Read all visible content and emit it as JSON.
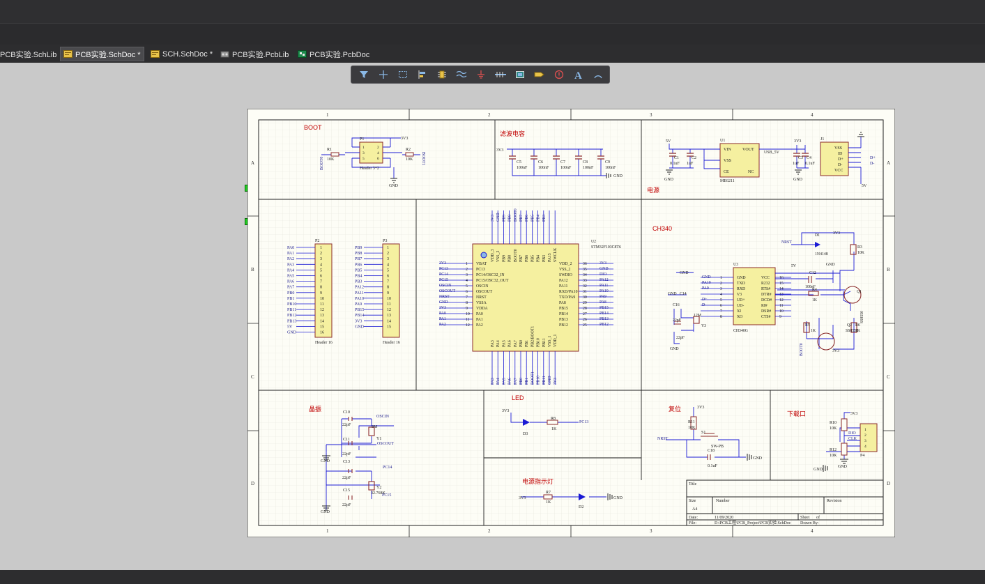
{
  "tabs": [
    {
      "label": "PCB实验.SchLib",
      "icon": "schlib-icon"
    },
    {
      "label": "PCB实验.SchDoc *",
      "icon": "schdoc-icon",
      "active": true
    },
    {
      "label": "SCH.SchDoc *",
      "icon": "schdoc-icon"
    },
    {
      "label": "PCB实验.PcbLib",
      "icon": "pcblib-icon"
    },
    {
      "label": "PCB实验.PcbDoc",
      "icon": "pcbdoc-icon"
    }
  ],
  "toolbar_icons": [
    "filter-icon",
    "cross-probe-icon",
    "select-rect-icon",
    "align-icon",
    "component-icon",
    "wire-icon",
    "ground-power-icon",
    "bus-icon",
    "sheet-symbol-icon",
    "port-icon",
    "directive-icon",
    "text-icon",
    "arc-icon"
  ],
  "colors": {
    "wire": "#1a1ad4",
    "part_fill": "#f5f0a0",
    "label_red": "#c00000",
    "net_blue": "#1a1a8c",
    "sheet_bg": "#fdfdf6",
    "grid": "#e4e4da"
  },
  "sheet": {
    "col_labels": [
      "1",
      "2",
      "3",
      "4"
    ],
    "row_labels": [
      "A",
      "B",
      "C",
      "D"
    ],
    "titles": {
      "boot": "BOOT",
      "filter": "滤波电容",
      "power": "电源",
      "ch340": "CH340",
      "crystal": "晶振",
      "led": "LED",
      "reset": "复位",
      "download": "下载口",
      "power_led": "电源指示灯"
    },
    "title_block": {
      "title": "Title",
      "size": "Size",
      "size_val": "A4",
      "number": "Number",
      "revision": "Revision",
      "date": "Date:",
      "date_val": "11/09/2020",
      "sheet": "Sheet",
      "of": "of",
      "file": "File:",
      "file_val": "D:\\PCB工程\\PCB_Project\\PCB实验.SchDoc",
      "drawn": "Drawn By:"
    },
    "parts": {
      "p1": "P1",
      "header32": "Header 3*2",
      "r1": "R1",
      "r2": "R2",
      "r10k": "10K",
      "boot0": "BOOT0",
      "boot1": "BOOT1",
      "v33": "3V3",
      "gnd": "GND",
      "c5": "C5",
      "c6": "C6",
      "c7": "C7",
      "c8": "C8",
      "c9": "C9",
      "c100nf": "100nF",
      "u1": "U1",
      "me6211": "ME6211",
      "vin": "VIN",
      "vout": "VOUT",
      "vss": "VSS",
      "ce": "CE",
      "nc": "NC",
      "c1": "C1",
      "c2": "C2",
      "c3": "C3",
      "c4": "C4",
      "c1uf": "1uF",
      "c01uf": "0.1uF",
      "v5": "5V",
      "usb_5v": "USB_5V",
      "j1": "J1",
      "j_id": "ID",
      "j_dp": "D+",
      "j_dm": "D-",
      "j_vcc": "VCC",
      "p2": "P2",
      "p3": "P3",
      "header16": "Header 16",
      "u2": "U2",
      "stm32": "STM32F103C8T6",
      "u3": "U3",
      "ch340g": "CH340G",
      "d1": "D1",
      "in4148": "1N4148",
      "r3": "R3",
      "r4": "R4",
      "r1k": "1K",
      "q1": "Q1",
      "q2": "Q2",
      "ss8550": "SS8550",
      "r5": "R5",
      "r6": "R6",
      "c12": "C12",
      "c14": "C14",
      "c16": "C16",
      "y3": "Y3",
      "y3_val": "12M",
      "c22pf": "22pF",
      "nrst": "NRST",
      "c10": "C10",
      "c11": "C11",
      "c13": "C13",
      "c15": "C15",
      "y1": "Y1",
      "y2": "Y2",
      "y1_val": "8M",
      "y2_val": "32.768K",
      "oscin": "OSCIN",
      "oscout": "OSCOUT",
      "pc14": "PC14",
      "pc15": "PC15",
      "d3": "D3",
      "r8": "R8",
      "pc13": "PC13",
      "r11": "R11",
      "s1": "S1",
      "swpb": "SW-PB",
      "c18": "C18",
      "r10": "R10",
      "r12": "R12",
      "p4": "P4",
      "dio": "DIO",
      "clk": "CLK",
      "r7": "R7",
      "d2": "D2"
    },
    "p2_pins": [
      "PA0",
      "PA1",
      "PA2",
      "PA3",
      "PA4",
      "PA5",
      "PA6",
      "PA7",
      "PB0",
      "PB1",
      "PB10",
      "PB11",
      "PB12",
      "PB13",
      "5V",
      "GND"
    ],
    "p3_pins": [
      "PB9",
      "PB8",
      "PB7",
      "PB6",
      "PB5",
      "PB4",
      "PB3",
      "PA12",
      "PA11",
      "PA10",
      "PA9",
      "PB15",
      "PB14",
      "3V3",
      "GND"
    ],
    "u2_left": [
      "VBAT",
      "PC13",
      "PC14/OSC32_IN",
      "PC15/OSC32_OUT",
      "OSCIN",
      "OSCOUT",
      "NRST",
      "VSSA",
      "VDDA",
      "PA0",
      "PA1",
      "PA2"
    ],
    "u2_left_nets": [
      "3V3",
      "PC13",
      "PC14",
      "PC15",
      "OSCIN",
      "OSCOUT",
      "NRST",
      "GND",
      "3V3",
      "PA0",
      "PA1",
      "PA2"
    ],
    "u2_right": [
      "VDD_2",
      "VSS_2",
      "SWDIO",
      "PA12",
      "PA11",
      "RXD/PA10",
      "TXD/PA9",
      "PA8",
      "PB15",
      "PB14",
      "PB13",
      "PB12"
    ],
    "u2_right_nets": [
      "3V3",
      "GND",
      "DIO",
      "PA12",
      "PA11",
      "PA10",
      "PA9",
      "PA8",
      "PB15",
      "PB14",
      "PB13",
      "PB12"
    ],
    "u2_right_nums": [
      "36",
      "35",
      "34",
      "33",
      "32",
      "31",
      "30",
      "29",
      "28",
      "27",
      "26",
      "25"
    ],
    "u2_top": [
      "VDD_3",
      "VSS_3",
      "PB9",
      "PB8",
      "BOOT0",
      "PB7",
      "PB6",
      "PB5",
      "PB4",
      "PB3",
      "PA15",
      "SWCLK"
    ],
    "u2_top_nets": [
      "3V3",
      "GND",
      "PB9",
      "PB8",
      "BOOT0",
      "PB7",
      "PB6",
      "PB5",
      "PB4",
      "PB3",
      "",
      ""
    ],
    "u2_bottom": [
      "PA3",
      "PA4",
      "PA5",
      "PA6",
      "PA7",
      "PB0",
      "PB1",
      "PB2/BOOT1",
      "PB10",
      "PB11",
      "VSS_1",
      "VDD_1"
    ],
    "u2_bottom_nets": [
      "PA3",
      "PA4",
      "PA5",
      "PA6",
      "PA7",
      "PB0",
      "PB1",
      "BOOT1",
      "PB10",
      "PB11",
      "GND",
      "3V3"
    ],
    "u3_left": [
      "GND",
      "TXD",
      "RXD",
      "V3",
      "UD+",
      "UD-",
      "XI",
      "XO"
    ],
    "u3_right": [
      "VCC",
      "R232",
      "RTS#",
      "DTR#",
      "DCD#",
      "RI#",
      "DSR#",
      "CTS#"
    ],
    "u3_left_nets": [
      "GND",
      "PA10",
      "PA9",
      "",
      "D+",
      "D-",
      "",
      ""
    ]
  }
}
